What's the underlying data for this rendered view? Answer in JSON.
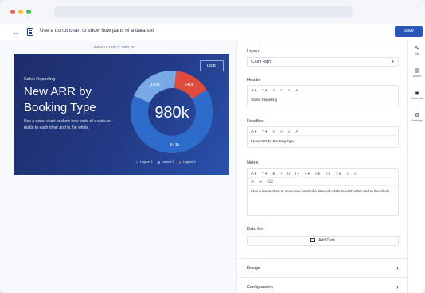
{
  "toolbar": {
    "back_icon": "arrow-left-icon",
    "page_icon": "document-icon",
    "title": "Use a donut chart to show how parts of a data set",
    "save_label": "Save"
  },
  "canvas": {
    "resolution": "FullHD ▾  1920 X 1080",
    "rotate_icon": "rotate-icon"
  },
  "slide": {
    "kicker": "Sales Reporting",
    "headline": "New ARR by Booking Type",
    "description": "Use a donut chart to show how parts of a data set relate to each other and to the whole.",
    "logo": "Logo",
    "center_value": "980k",
    "colors": {
      "background": "#233a86",
      "series1": "#2e6ccc",
      "series2": "#7aaae6",
      "series3": "#e04a3f"
    }
  },
  "chart_data": {
    "type": "pie",
    "categories": [
      "Legend 1",
      "Legend 2",
      "Legend 3"
    ],
    "values": [
      641,
      199,
      140
    ],
    "labels": [
      "641k",
      "199k",
      "140k"
    ],
    "center_label": "980k"
  },
  "panel": {
    "layout_label": "Layout",
    "layout_value": "Chart Right",
    "header_label": "Header",
    "header_value": "Sales Reporting",
    "headline_label": "Headline",
    "headline_value": "New ARR by Booking Type",
    "notes_label": "Notes",
    "notes_value": "Use a donut chart to show how parts of a data set relate to each other and to the whole.",
    "dataset_label": "Data Set",
    "add_data_label": "Add Data",
    "design_label": "Design",
    "configuration_label": "Configuration"
  },
  "rte_simple": [
    "A ▾",
    "T ▾",
    "≡",
    "≡",
    "≡",
    "A"
  ],
  "rte_full_row1": [
    "A ▾",
    "T ▾",
    "B",
    "I",
    "U",
    "I ▾",
    "≡ ▾",
    "≡ ▾",
    "≡ ▾",
    "≡ ▾",
    "≡",
    "≡"
  ],
  "rte_full_row2": [
    "A",
    "∞",
    "⌫"
  ],
  "rail": [
    {
      "icon": "edit-icon",
      "glyph": "✎",
      "label": "Edit"
    },
    {
      "icon": "article-icon",
      "glyph": "▤",
      "label": "Article"
    },
    {
      "icon": "schedule-icon",
      "glyph": "▣",
      "label": "Schedule"
    },
    {
      "icon": "settings-icon",
      "glyph": "⚙",
      "label": "Settings"
    }
  ]
}
